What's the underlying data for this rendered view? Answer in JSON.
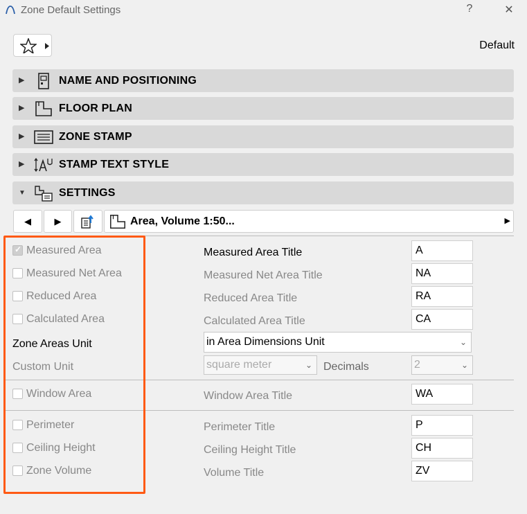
{
  "window": {
    "title": "Zone Default Settings",
    "help": "?",
    "close": "✕"
  },
  "header": {
    "default_label": "Default"
  },
  "sections": [
    {
      "label": "NAME AND POSITIONING",
      "expanded": false
    },
    {
      "label": "FLOOR PLAN",
      "expanded": false
    },
    {
      "label": "ZONE STAMP",
      "expanded": false
    },
    {
      "label": "STAMP TEXT STYLE",
      "expanded": false
    },
    {
      "label": "SETTINGS",
      "expanded": true
    }
  ],
  "settings": {
    "preset": "Area, Volume 1:50...",
    "measured_area": {
      "label": "Measured Area",
      "checked": true,
      "title_label": "Measured Area Title",
      "title_value": "A"
    },
    "measured_net_area": {
      "label": "Measured Net Area",
      "checked": false,
      "title_label": "Measured Net Area Title",
      "title_value": "NA"
    },
    "reduced_area": {
      "label": "Reduced Area",
      "checked": false,
      "title_label": "Reduced Area Title",
      "title_value": "RA"
    },
    "calculated_area": {
      "label": "Calculated Area",
      "checked": false,
      "title_label": "Calculated Area Title",
      "title_value": "CA"
    },
    "zone_areas_unit": {
      "label": "Zone Areas Unit",
      "value": "in Area Dimensions Unit"
    },
    "custom_unit": {
      "label": "Custom Unit",
      "value": "square meter",
      "decimals_label": "Decimals",
      "decimals_value": "2"
    },
    "window_area": {
      "label": "Window Area",
      "checked": false,
      "title_label": "Window Area Title",
      "title_value": "WA"
    },
    "perimeter": {
      "label": "Perimeter",
      "checked": false,
      "title_label": "Perimeter Title",
      "title_value": "P"
    },
    "ceiling_height": {
      "label": "Ceiling Height",
      "checked": false,
      "title_label": "Ceiling Height Title",
      "title_value": "CH"
    },
    "zone_volume": {
      "label": "Zone Volume",
      "checked": false,
      "title_label": "Volume Title",
      "title_value": "ZV"
    }
  },
  "colors": {
    "highlight": "#ff5a14",
    "section_bg": "#d9d9d9",
    "accent": "#1e78d2"
  }
}
